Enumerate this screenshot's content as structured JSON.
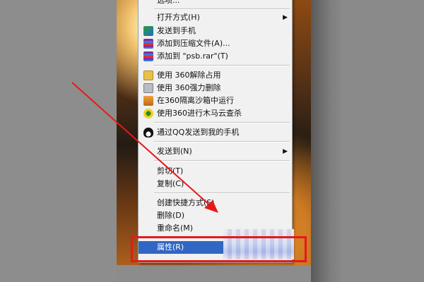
{
  "menu": {
    "top_partial_label": "选项...",
    "items": [
      {
        "label": "打开方式(H)",
        "icon": "none",
        "submenu": true
      },
      {
        "label": "发送到手机",
        "icon": "phone-send-icon"
      },
      {
        "label": "添加到压缩文件(A)...",
        "icon": "archive-icon"
      },
      {
        "label": "添加到 \"psb.rar\"(T)",
        "icon": "archive-icon"
      },
      {
        "label": "使用 360解除占用",
        "icon": "unlock-360-icon"
      },
      {
        "label": "使用 360强力删除",
        "icon": "shredder-icon"
      },
      {
        "label": "在360隔离沙箱中运行",
        "icon": "sandbox-icon"
      },
      {
        "label": "使用360进行木马云查杀",
        "icon": "trojan-scan-icon"
      },
      {
        "label": "通过QQ发送到我的手机",
        "icon": "qq-icon"
      },
      {
        "label": "发送到(N)",
        "icon": "none",
        "submenu": true
      },
      {
        "label": "剪切(T)",
        "icon": "none"
      },
      {
        "label": "复制(C)",
        "icon": "none"
      },
      {
        "label": "创建快捷方式(S)",
        "icon": "none"
      },
      {
        "label": "删除(D)",
        "icon": "none"
      },
      {
        "label": "重命名(M)",
        "icon": "none"
      },
      {
        "label": "属性(R)",
        "icon": "none",
        "selected": true
      }
    ]
  },
  "colors": {
    "selection": "#3166c4",
    "menu_bg": "#f1f1f1",
    "annotation": "#e41a1a"
  }
}
